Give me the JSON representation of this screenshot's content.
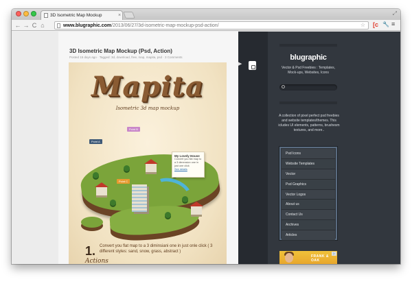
{
  "browser": {
    "tab_title": "3D Isometric Map Mockup",
    "tab_close": "×",
    "url_host": "www.blugraphic.com",
    "url_path": "/2013/06/27/3d-isometric-map-mockup-psd-action/",
    "nav": {
      "back": "←",
      "forward": "→",
      "reload": "C",
      "home": "⌂"
    },
    "icons": {
      "star": "☆",
      "extension": "[c",
      "wrench": "🔧",
      "menu": "≡",
      "resize": "⤢"
    },
    "colors": {
      "close": "#fc605c",
      "minimize": "#fdbc40",
      "maximize": "#34c84a"
    }
  },
  "post": {
    "title": "3D Isometric Map Mockup (Psd, Action)",
    "meta": "Posted 15 days ago · Tagged: 3d, download, free, map, mapita, psd · 3 Comments"
  },
  "image": {
    "logo": "Mapita",
    "subtitle": "Isometric 3d map mockup",
    "tags": [
      "Point A",
      "Point B",
      "Point C"
    ],
    "callout": {
      "title": "My Lovely House",
      "body": "Convert you flat map to a 3 dimension one in just one click",
      "link": "See details"
    },
    "step_number": "1.",
    "step_text": "Convert you flat map to a 3 diminsiani one in just onle click ( 3 different styles: sand, snow, grass, abstract )",
    "actions_heading": "Actions"
  },
  "sidebar": {
    "brand": "blugraphic",
    "tagline": "Vector & Psd Freebies : Templates, Mock-ups, Websites, Icons",
    "about": "A collection of pixel perfect psd freebies and website templates/themes. This icludes UI elements, patterns, brushesm textures, and more..",
    "menu": [
      "Psd Icons",
      "Website Templates",
      "Vector",
      "Psd Graphics",
      "Vector Logos",
      "About us",
      "Contact Us",
      "Archives",
      "Articles"
    ],
    "ad": {
      "text": "FRANK & OAK",
      "choice": "▷"
    },
    "colors": {
      "panel": "#32373e",
      "strip": "#262a30",
      "menu_border": "#5a6b80"
    }
  }
}
